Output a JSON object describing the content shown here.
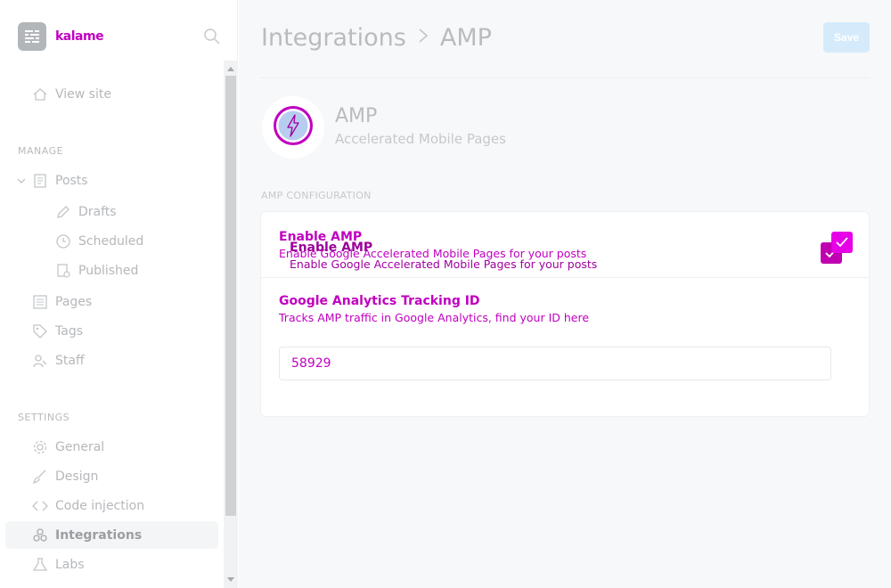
{
  "brand": {
    "name": "kalame",
    "logo_icon": "blog-logo-icon"
  },
  "sidebar": {
    "search_icon": "search-icon",
    "view_site": {
      "label": "View site",
      "icon": "home-icon"
    },
    "manage_title": "MANAGE",
    "posts": {
      "label": "Posts",
      "icon": "document-icon",
      "expanded": true,
      "children": [
        {
          "label": "Drafts",
          "icon": "pencil-icon"
        },
        {
          "label": "Scheduled",
          "icon": "clock-icon"
        },
        {
          "label": "Published",
          "icon": "published-icon"
        }
      ]
    },
    "pages": {
      "label": "Pages",
      "icon": "pages-icon"
    },
    "tags": {
      "label": "Tags",
      "icon": "tag-icon"
    },
    "staff": {
      "label": "Staff",
      "icon": "staff-icon"
    },
    "settings_title": "SETTINGS",
    "general": {
      "label": "General",
      "icon": "gear-icon"
    },
    "design": {
      "label": "Design",
      "icon": "brush-icon"
    },
    "code_injection": {
      "label": "Code injection",
      "icon": "code-icon"
    },
    "integrations": {
      "label": "Integrations",
      "icon": "integrations-icon",
      "active": true
    },
    "labs": {
      "label": "Labs",
      "icon": "flask-icon"
    }
  },
  "header": {
    "breadcrumb_parent": "Integrations",
    "breadcrumb_current": "AMP",
    "save_label": "Save"
  },
  "integration": {
    "title": "AMP",
    "subtitle": "Accelerated Mobile Pages",
    "icon": "amp-lightning-icon"
  },
  "config": {
    "section_title": "AMP CONFIGURATION",
    "enable_amp": {
      "label": "Enable AMP",
      "description": "Enable Google Accelerated Mobile Pages for your posts",
      "checked": true
    },
    "ga_tracking": {
      "label": "Google Analytics Tracking ID",
      "description": "Tracks AMP traffic in Google Analytics, find your ID here",
      "value": "58929"
    }
  },
  "colors": {
    "accent": "#c000c0",
    "save_button": "#d5ebfb",
    "active_nav_bg": "#f4f5f6"
  }
}
